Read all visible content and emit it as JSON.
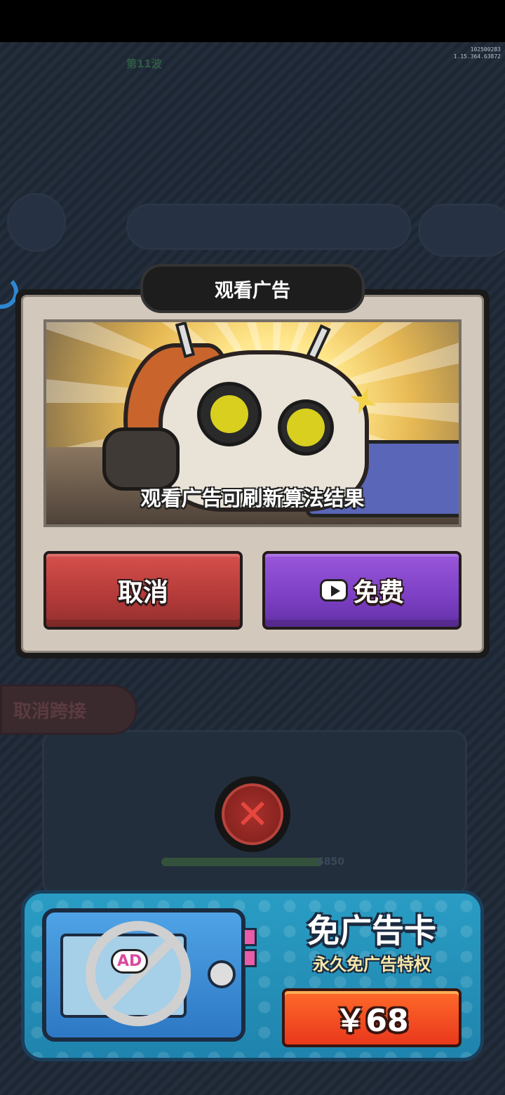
{
  "status": {
    "build_id": "102500283",
    "version": "1.15.364.63872"
  },
  "background": {
    "wave_label": "第11波",
    "dim_button": "取消跨接",
    "dim_number": "6850"
  },
  "dialog": {
    "title": "观看广告",
    "image_caption": "观看广告可刷新算法结果",
    "cancel_label": "取消",
    "free_label": "免费",
    "free_icon": "video-play-icon"
  },
  "close": {
    "icon": "close-x-icon"
  },
  "promo": {
    "title": "免广告卡",
    "subtitle": "永久免广告特权",
    "price": "￥68",
    "card_badge": "AD"
  },
  "colors": {
    "cancel": "#c24442",
    "free": "#7e44c6",
    "price": "#f0461e",
    "banner": "#2491bb"
  }
}
